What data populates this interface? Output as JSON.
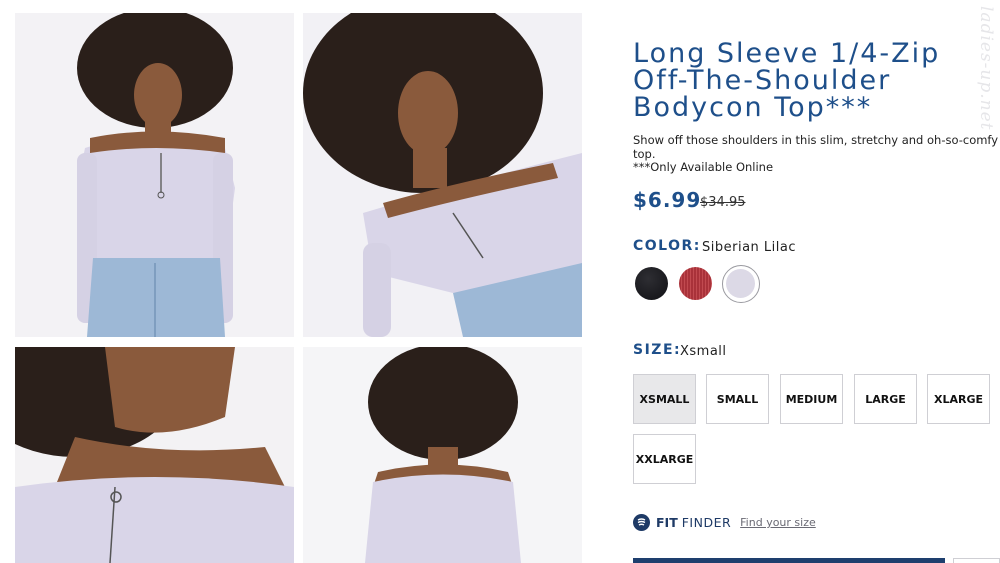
{
  "watermark": "ladies-up.net",
  "product": {
    "title": "Long Sleeve 1/4-Zip Off-The-Shoulder Bodycon Top***",
    "description": "Show off those shoulders in this slim, stretchy and oh-so-comfy top.",
    "availability_note": "***Only Available Online",
    "sale_price": "$6.99",
    "original_price": "$34.95"
  },
  "color": {
    "label": "COLOR:",
    "selected": "Siberian Lilac",
    "swatches": [
      {
        "name": "Black",
        "hex": "#18181c"
      },
      {
        "name": "Red",
        "hex": "#b33b42"
      },
      {
        "name": "Siberian Lilac",
        "hex": "#dcd9e6",
        "selected": true
      }
    ]
  },
  "size": {
    "label": "SIZE:",
    "selected": "Xsmall",
    "options": [
      "XSMALL",
      "SMALL",
      "MEDIUM",
      "LARGE",
      "XLARGE",
      "XXLARGE"
    ]
  },
  "fit_finder": {
    "brand_bold": "FIT",
    "brand_light": "FINDER",
    "link": "Find your size"
  },
  "theme": {
    "accent": "#1e4f8a",
    "top_color": "#d9d5e8",
    "denim": "#9db8d6",
    "hair": "#2a1f1a",
    "skin": "#8a5a3c"
  }
}
